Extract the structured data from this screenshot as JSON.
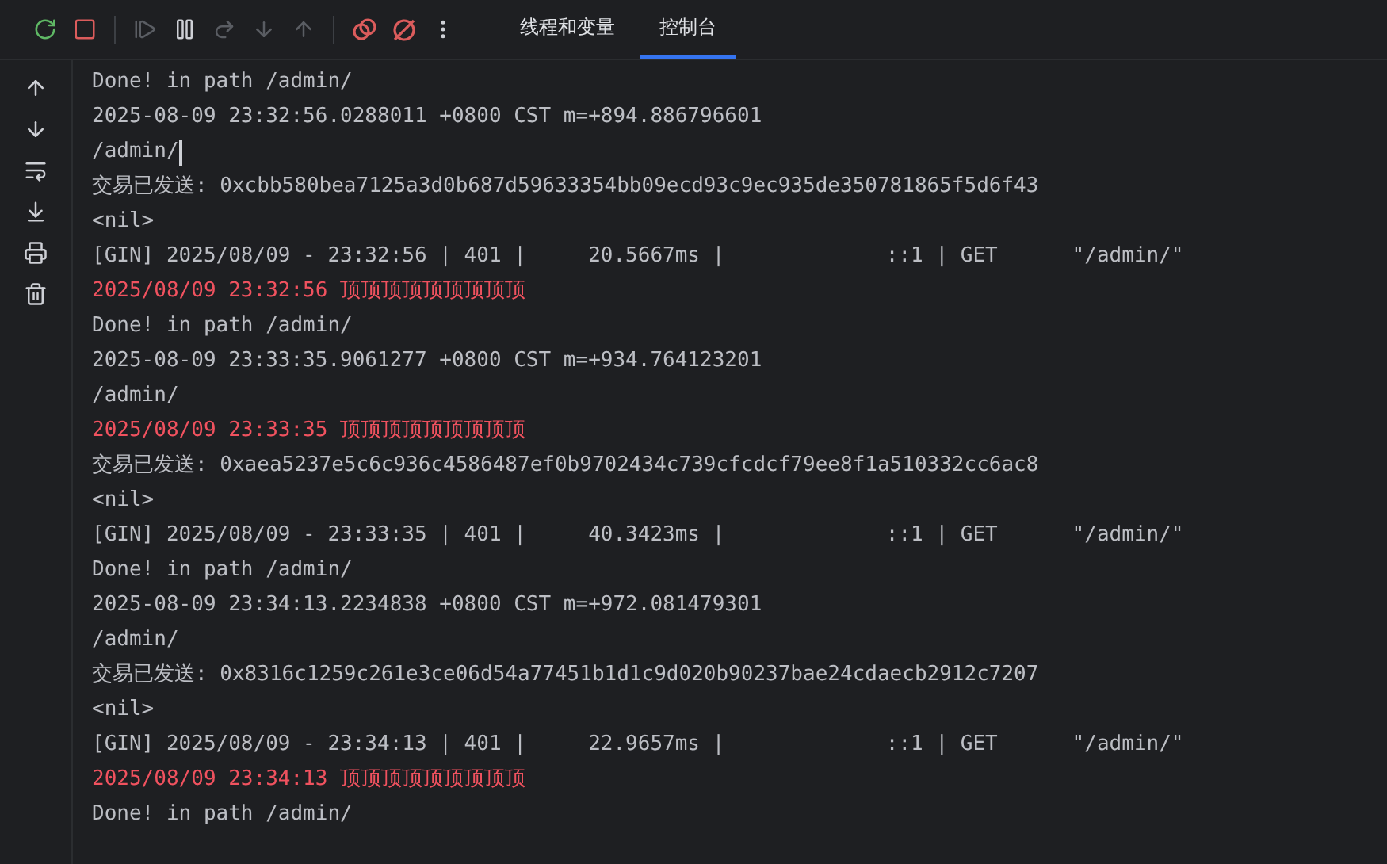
{
  "toolbar": [
    {
      "kind": "rerun",
      "disabled": false
    },
    {
      "kind": "stop",
      "disabled": false
    },
    {
      "kind": "separator"
    },
    {
      "kind": "resume",
      "disabled": true
    },
    {
      "kind": "pause",
      "disabled": false
    },
    {
      "kind": "step_over",
      "disabled": true
    },
    {
      "kind": "step_into",
      "disabled": true
    },
    {
      "kind": "step_out",
      "disabled": true
    },
    {
      "kind": "separator"
    },
    {
      "kind": "breakpoints",
      "disabled": false
    },
    {
      "kind": "mute",
      "disabled": false
    },
    {
      "kind": "more",
      "disabled": false
    }
  ],
  "tabs": [
    {
      "label": "线程和变量",
      "selected": false
    },
    {
      "label": "控制台",
      "selected": true
    }
  ],
  "gutter": [
    {
      "kind": "up"
    },
    {
      "kind": "down"
    },
    {
      "kind": "wrap"
    },
    {
      "kind": "scroll_end"
    },
    {
      "kind": "print"
    },
    {
      "kind": "trash"
    }
  ],
  "console": [
    {
      "kind": "plain",
      "text": "Done! in path /admin/",
      "caret": false
    },
    {
      "kind": "plain",
      "text": "2025-08-09 23:32:56.0288011 +0800 CST m=+894.886796601",
      "caret": false
    },
    {
      "kind": "plain",
      "text": "/admin/",
      "caret": true
    },
    {
      "kind": "plain",
      "text": "交易已发送: 0xcbb580bea7125a3d0b687d59633354bb09ecd93c9ec935de350781865f5d6f43",
      "caret": false
    },
    {
      "kind": "plain",
      "text": "<nil>",
      "caret": false
    },
    {
      "kind": "plain",
      "text": "[GIN] 2025/08/09 - 23:32:56 | 401 |     20.5667ms |             ::1 | GET      \"/admin/\"",
      "caret": false
    },
    {
      "kind": "error",
      "text": "2025/08/09 23:32:56 顶顶顶顶顶顶顶顶顶",
      "caret": false
    },
    {
      "kind": "plain",
      "text": "Done! in path /admin/",
      "caret": false
    },
    {
      "kind": "plain",
      "text": "2025-08-09 23:33:35.9061277 +0800 CST m=+934.764123201",
      "caret": false
    },
    {
      "kind": "plain",
      "text": "/admin/",
      "caret": false
    },
    {
      "kind": "error",
      "text": "2025/08/09 23:33:35 顶顶顶顶顶顶顶顶顶",
      "caret": false
    },
    {
      "kind": "plain",
      "text": "交易已发送: 0xaea5237e5c6c936c4586487ef0b9702434c739cfcdcf79ee8f1a510332cc6ac8",
      "caret": false
    },
    {
      "kind": "plain",
      "text": "<nil>",
      "caret": false
    },
    {
      "kind": "plain",
      "text": "[GIN] 2025/08/09 - 23:33:35 | 401 |     40.3423ms |             ::1 | GET      \"/admin/\"",
      "caret": false
    },
    {
      "kind": "plain",
      "text": "Done! in path /admin/",
      "caret": false
    },
    {
      "kind": "plain",
      "text": "2025-08-09 23:34:13.2234838 +0800 CST m=+972.081479301",
      "caret": false
    },
    {
      "kind": "plain",
      "text": "/admin/",
      "caret": false
    },
    {
      "kind": "plain",
      "text": "交易已发送: 0x8316c1259c261e3ce06d54a77451b1d1c9d020b90237bae24cdaecb2912c7207",
      "caret": false
    },
    {
      "kind": "plain",
      "text": "<nil>",
      "caret": false
    },
    {
      "kind": "plain",
      "text": "[GIN] 2025/08/09 - 23:34:13 | 401 |     22.9657ms |             ::1 | GET      \"/admin/\"",
      "caret": false
    },
    {
      "kind": "error",
      "text": "2025/08/09 23:34:13 顶顶顶顶顶顶顶顶顶",
      "caret": false
    },
    {
      "kind": "plain",
      "text": "Done! in path /admin/",
      "caret": false
    }
  ]
}
